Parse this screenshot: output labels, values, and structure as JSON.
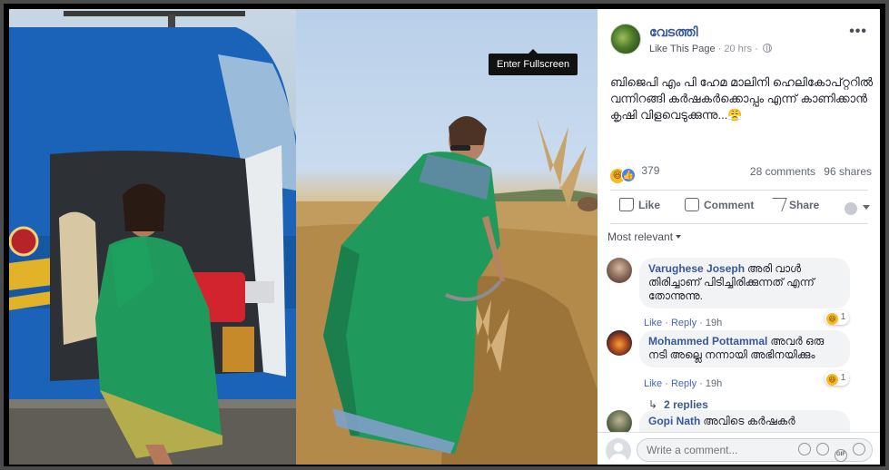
{
  "tooltip": {
    "enter_fullscreen": "Enter Fullscreen"
  },
  "post": {
    "page_name": "വേടത്തി",
    "like_page": "Like This Page",
    "time": "20 hrs",
    "separator": "·",
    "more": "•••",
    "text": "ബിജെപി എം പി ഹേമ മാലിനി ഹെലികോപ്റ്ററിൽ വന്നിറങ്ങി കർഷകർക്കൊപ്പം എന്ന് കാണിക്കാൻ കൃഷി വിളവെടുക്കുന്നു...😤",
    "reaction_count": "379",
    "comments_count": "28 comments",
    "shares_count": "96 shares"
  },
  "actions": {
    "like": "Like",
    "comment": "Comment",
    "share": "Share"
  },
  "sort": {
    "label": "Most relevant"
  },
  "comments": [
    {
      "author": "Varughese Joseph",
      "text": "അരി വാൾ തിരിച്ചാണ് പിടിച്ചിരിക്കുന്നത് എന്ന് തോന്നുന്നു.",
      "like": "Like",
      "reply": "Reply",
      "time": "19h",
      "reactions": "1"
    },
    {
      "author": "Mohammed Pottammal",
      "text": "അവർ ഒരു നടി അല്ലെ നന്നായി അഭിനയിക്കും",
      "like": "Like",
      "reply": "Reply",
      "time": "19h",
      "reactions": "1"
    },
    {
      "author": "Gopi Nath",
      "text": "അവിടെ കർഷകർ"
    }
  ],
  "replies": {
    "label": "2 replies"
  },
  "composer": {
    "placeholder": "Write a comment..."
  },
  "colors": {
    "link_blue": "#365899",
    "text": "#1d2129",
    "muted": "#90949c",
    "bubble": "#f2f3f5",
    "saree_green": "#1f9a5c",
    "helicopter_blue": "#1b63b8"
  },
  "icons": [
    "globe-icon",
    "more-icon",
    "haha-reaction-icon",
    "like-reaction-icon",
    "like-icon",
    "comment-icon",
    "share-icon",
    "audience-icon",
    "chevron-down-icon",
    "reply-arrow-icon",
    "emoji-icon",
    "camera-icon",
    "gif-icon",
    "sticker-icon"
  ]
}
